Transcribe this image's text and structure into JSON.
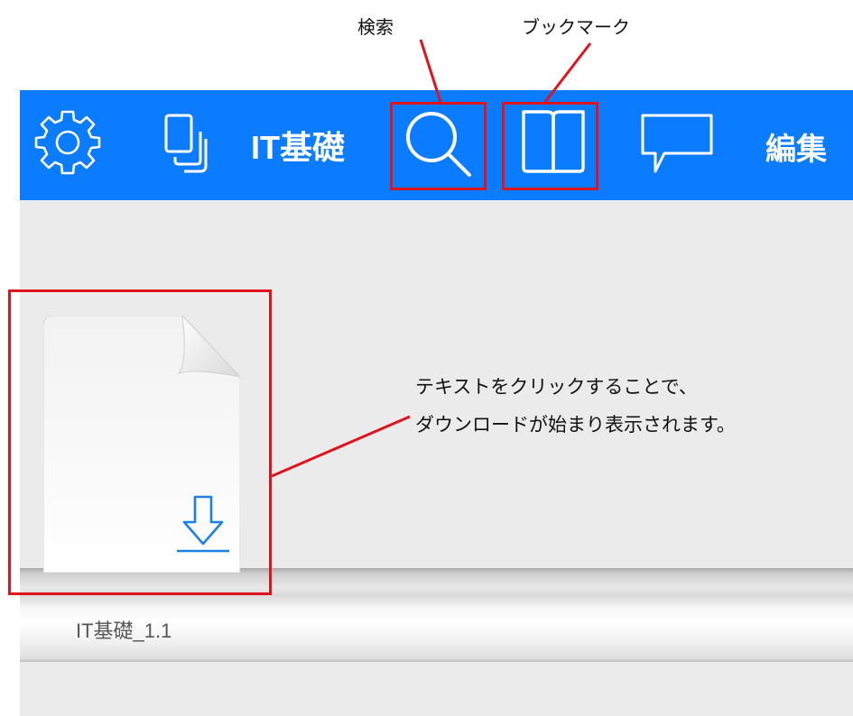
{
  "callouts": {
    "search": "検索",
    "bookmark": "ブックマーク"
  },
  "toolbar": {
    "title": "IT基礎",
    "edit_label": "編集",
    "icons": [
      "gear-icon",
      "copy-icon",
      "search-icon",
      "book-icon",
      "comment-icon"
    ],
    "background": "#0b7cff"
  },
  "content": {
    "book_title": "IT基礎_1.1",
    "instruction_lines": [
      "テキストをクリックすることで、",
      "ダウンロードが始まり表示されます。"
    ]
  },
  "colors": {
    "highlight": "#e0141e",
    "download_icon": "#1a7fe8"
  }
}
